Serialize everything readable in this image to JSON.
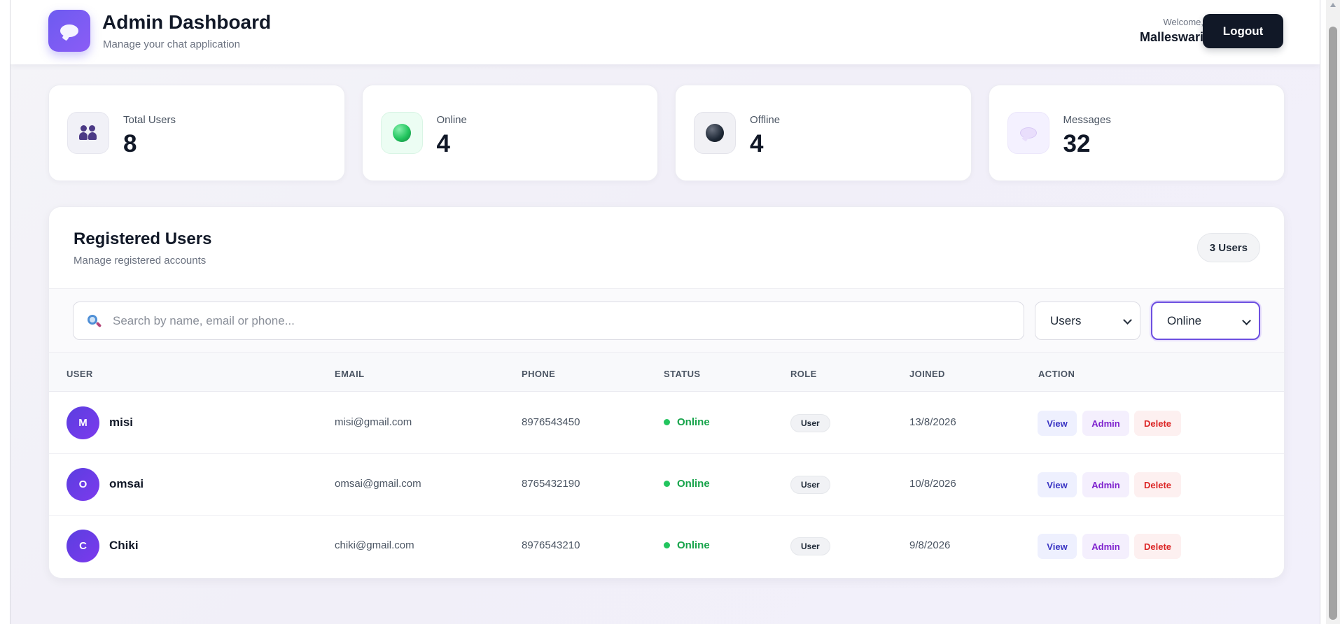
{
  "header": {
    "title": "Admin Dashboard",
    "subtitle": "Manage your chat application",
    "welcome_label": "Welcome,",
    "user_name": "Malleswari",
    "logout_label": "Logout"
  },
  "stats": [
    {
      "label": "Total Users",
      "value": "8",
      "icon": "users-icon"
    },
    {
      "label": "Online",
      "value": "4",
      "icon": "online-dot-icon"
    },
    {
      "label": "Offline",
      "value": "4",
      "icon": "offline-dot-icon"
    },
    {
      "label": "Messages",
      "value": "32",
      "icon": "chat-bubble-icon"
    }
  ],
  "panel": {
    "title": "Registered Users",
    "subtitle": "Manage registered accounts",
    "count_badge": "3 Users"
  },
  "filters": {
    "search_placeholder": "Search by name, email or phone...",
    "search_value": "",
    "type_selected": "Users",
    "status_selected": "Online"
  },
  "table": {
    "columns": [
      "USER",
      "EMAIL",
      "PHONE",
      "STATUS",
      "ROLE",
      "JOINED",
      "ACTION"
    ],
    "rows": [
      {
        "initial": "M",
        "name": "misi",
        "email": "misi@gmail.com",
        "phone": "8976543450",
        "status": "Online",
        "role": "User",
        "joined": "13/8/2026"
      },
      {
        "initial": "O",
        "name": "omsai",
        "email": "omsai@gmail.com",
        "phone": "8765432190",
        "status": "Online",
        "role": "User",
        "joined": "10/8/2026"
      },
      {
        "initial": "C",
        "name": "Chiki",
        "email": "chiki@gmail.com",
        "phone": "8976543210",
        "status": "Online",
        "role": "User",
        "joined": "9/8/2026"
      }
    ],
    "actions": {
      "view": "View",
      "admin": "Admin",
      "delete": "Delete"
    }
  },
  "colors": {
    "accent": "#6d5bf0",
    "dark": "#111827",
    "online": "#16a34a",
    "danger": "#dc2626"
  }
}
